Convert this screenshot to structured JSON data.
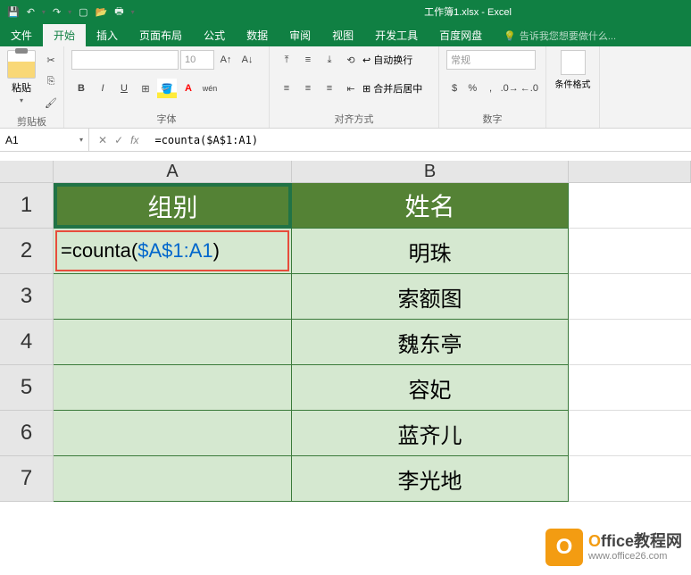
{
  "app": {
    "title": "工作簿1.xlsx - Excel"
  },
  "tabs": {
    "items": [
      "文件",
      "开始",
      "插入",
      "页面布局",
      "公式",
      "数据",
      "审阅",
      "视图",
      "开发工具",
      "百度网盘"
    ],
    "active": 1,
    "tell_me": "告诉我您想要做什么..."
  },
  "ribbon": {
    "clipboard": {
      "paste": "粘贴",
      "label": "剪贴板"
    },
    "font": {
      "font_name": "",
      "font_size": "10",
      "label": "字体",
      "ruby": "wén"
    },
    "alignment": {
      "wrap": "自动换行",
      "merge": "合并后居中",
      "label": "对齐方式"
    },
    "number": {
      "format": "常规",
      "label": "数字"
    },
    "styles": {
      "cond": "条件格式"
    }
  },
  "formula_bar": {
    "name_box": "A1",
    "formula": "=counta($A$1:A1)"
  },
  "grid": {
    "columns": [
      "A",
      "B"
    ],
    "headers": {
      "A": "组别",
      "B": "姓名"
    },
    "formula_display": {
      "prefix": "=counta(",
      "ref": "$A$1:A1",
      "suffix": ")"
    },
    "rows": [
      {
        "num": 1,
        "A": "组别",
        "B": "姓名"
      },
      {
        "num": 2,
        "A": "=counta($A$1:A1)",
        "B": "明珠"
      },
      {
        "num": 3,
        "A": "",
        "B": "索额图"
      },
      {
        "num": 4,
        "A": "",
        "B": "魏东亭"
      },
      {
        "num": 5,
        "A": "",
        "B": "容妃"
      },
      {
        "num": 6,
        "A": "",
        "B": "蓝齐儿"
      },
      {
        "num": 7,
        "A": "",
        "B": "李光地"
      }
    ]
  },
  "watermark": {
    "line1_prefix": "O",
    "line1_rest": "ffice教程网",
    "line2": "www.office26.com"
  }
}
